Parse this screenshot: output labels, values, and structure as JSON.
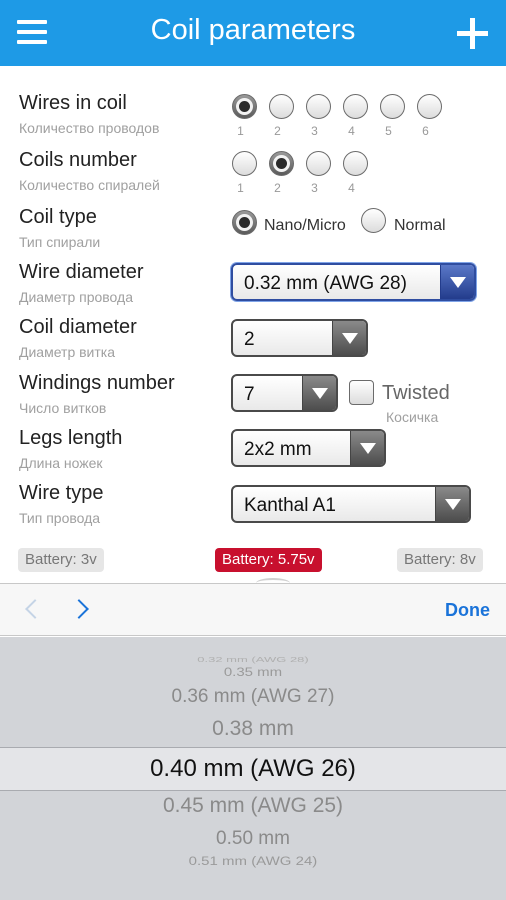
{
  "navbar": {
    "title": "Coil parameters",
    "menu_icon": "menu-icon",
    "add_icon": "plus-icon"
  },
  "form": {
    "wires_in_coil": {
      "label": "Wires in coil",
      "sublabel": "Количество проводов",
      "options": [
        "1",
        "2",
        "3",
        "4",
        "5",
        "6"
      ],
      "selected": "1"
    },
    "coils_number": {
      "label": "Coils number",
      "sublabel": "Количество спиралей",
      "options": [
        "1",
        "2",
        "3",
        "4"
      ],
      "selected": "2"
    },
    "coil_type": {
      "label": "Coil type",
      "sublabel": "Тип спирали",
      "options": [
        "Nano/Micro",
        "Normal"
      ],
      "selected": "Nano/Micro"
    },
    "wire_diameter": {
      "label": "Wire diameter",
      "sublabel": "Диаметр провода",
      "value": "0.32 mm (AWG 28)"
    },
    "coil_diameter": {
      "label": "Coil diameter",
      "sublabel": "Диаметр витка",
      "value": "2"
    },
    "windings_number": {
      "label": "Windings number",
      "sublabel": "Число витков",
      "value": "7",
      "twisted_label": "Twisted",
      "twisted_sublabel": "Косичка",
      "twisted_checked": false
    },
    "legs_length": {
      "label": "Legs length",
      "sublabel": "Длина ножек",
      "value": "2x2 mm"
    },
    "wire_type": {
      "label": "Wire type",
      "sublabel": "Тип провода",
      "value": "Kanthal A1"
    }
  },
  "battery": {
    "low": "Battery: 3v",
    "current": "Battery: 5.75v",
    "high": "Battery: 8v"
  },
  "toolbar": {
    "done_label": "Done"
  },
  "picker": {
    "items": [
      "0.32 mm (AWG 28)",
      "0.35 mm",
      "0.36 mm (AWG 27)",
      "0.38 mm",
      "0.40 mm (AWG 26)",
      "0.45 mm (AWG 25)",
      "0.50 mm",
      "0.51 mm (AWG 24)"
    ],
    "selected": "0.40 mm (AWG 26)"
  },
  "colors": {
    "navbar": "#1e9ae6",
    "accent": "#1a73d9",
    "battery_active": "#c8102e"
  }
}
